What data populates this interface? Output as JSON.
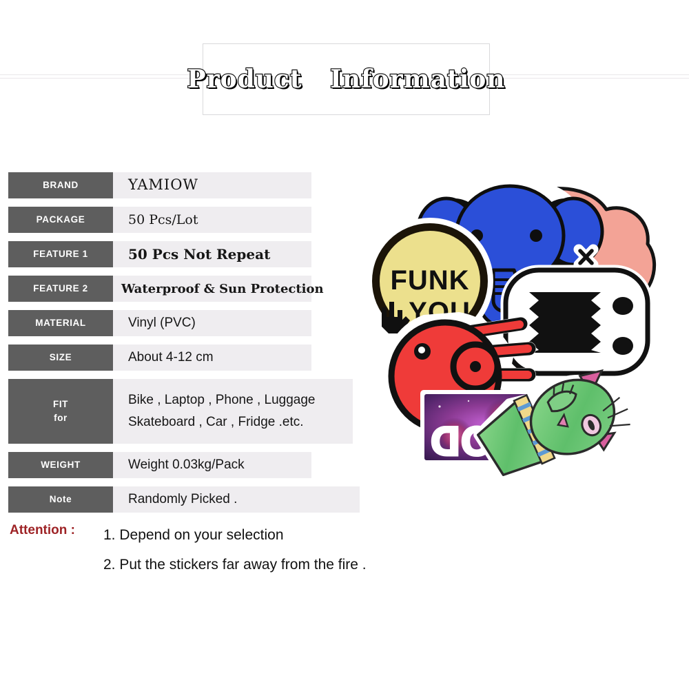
{
  "header": {
    "title": "Product   Information"
  },
  "spec_table": {
    "rows": [
      {
        "id": "brand",
        "label": "BRAND",
        "value": "YAMIOW"
      },
      {
        "id": "package",
        "label": "PACKAGE",
        "value": "50 Pcs/Lot"
      },
      {
        "id": "f1",
        "label": "FEATURE 1",
        "value": "50 Pcs Not Repeat"
      },
      {
        "id": "f2",
        "label": "FEATURE 2",
        "value": "Waterproof & Sun Protection"
      },
      {
        "id": "material",
        "label": "MATERIAL",
        "value": "Vinyl (PVC)"
      },
      {
        "id": "size",
        "label": "SIZE",
        "value": "About 4-12 cm"
      },
      {
        "id": "fit",
        "label_line1": "FIT",
        "label_line2": "for",
        "value_line1": "Bike , Laptop , Phone , Luggage",
        "value_line2": "Skateboard , Car , Fridge .etc."
      },
      {
        "id": "weight",
        "label": "WEIGHT",
        "value": "Weight 0.03kg/Pack"
      },
      {
        "id": "note",
        "label": "Note",
        "value": "Randomly Picked ."
      }
    ]
  },
  "attention": {
    "label": "Attention :",
    "items": [
      "1. Depend on your selection",
      "2. Put the stickers far away from the fire ."
    ]
  },
  "stickers": {
    "items": [
      {
        "name": "funk-you-badge-sticker",
        "text_line1": "FUNK",
        "text_line2": "YOU",
        "color": "#ece08d"
      },
      {
        "name": "blue-elephant-sticker",
        "color": "#2b4fd8"
      },
      {
        "name": "pink-blob-sticker",
        "color": "#f3a396"
      },
      {
        "name": "domo-tv-sticker",
        "color": "#ffffff"
      },
      {
        "name": "red-hand-eye-sticker",
        "color": "#ef3b39"
      },
      {
        "name": "galaxy-good-sticker",
        "text": "GOOD",
        "color": "#6b2a78"
      },
      {
        "name": "green-cat-sticker",
        "color": "#63c06a"
      }
    ]
  },
  "colors": {
    "label_bg": "#5e5e5e",
    "value_bg": "#efedf0",
    "attention_red": "#9e2326",
    "rule": "#e9e7ea"
  }
}
